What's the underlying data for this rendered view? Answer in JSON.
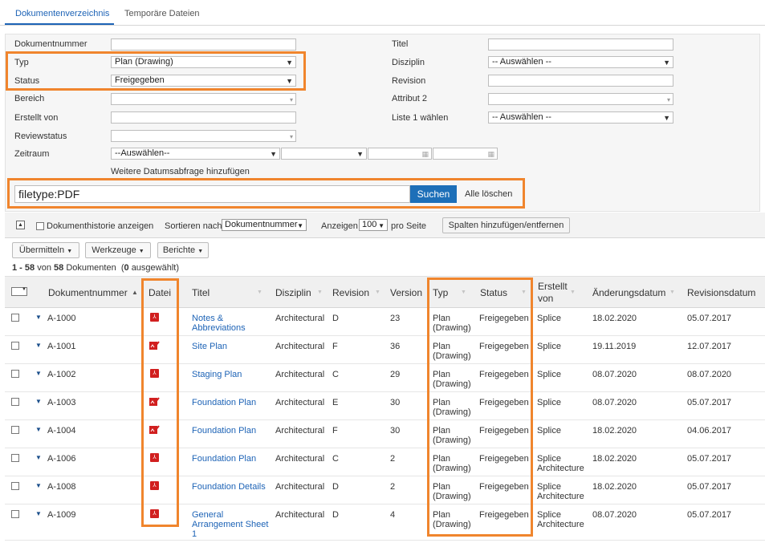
{
  "tabs": [
    {
      "label": "Dokumentenverzeichnis"
    },
    {
      "label": "Temporäre Dateien"
    }
  ],
  "filters": {
    "dokumentnummer_label": "Dokumentnummer",
    "typ_label": "Typ",
    "typ_value": "Plan (Drawing)",
    "status_label": "Status",
    "status_value": "Freigegeben",
    "bereich_label": "Bereich",
    "erstellt_von_label": "Erstellt von",
    "reviewstatus_label": "Reviewstatus",
    "zeitraum_label": "Zeitraum",
    "zeitraum_value": "--Auswählen--",
    "weitere_link": "Weitere Datumsabfrage hinzufügen",
    "titel_label": "Titel",
    "disziplin_label": "Disziplin",
    "disziplin_value": "-- Auswählen --",
    "revision_label": "Revision",
    "attribut2_label": "Attribut 2",
    "liste1_label": "Liste 1 wählen",
    "liste1_value": "-- Auswählen --"
  },
  "search": {
    "query": "filetype:PDF",
    "button_label": "Suchen",
    "clear_label": "Alle löschen"
  },
  "toolbar": {
    "history_label": "Dokumenthistorie anzeigen",
    "sort_label": "Sortieren nach",
    "sort_value": "Dokumentnummer",
    "show_label": "Anzeigen",
    "show_value": "100",
    "per_page_label": "pro Seite",
    "columns_button": "Spalten hinzufügen/entfernen",
    "submit_button": "Übermitteln",
    "tools_button": "Werkzeuge",
    "reports_button": "Berichte"
  },
  "count": {
    "range": "1 - 58",
    "von": "von",
    "total": "58",
    "docs": "Dokumenten",
    "open_paren": "(",
    "selected": "0",
    "selected_suffix": "ausgewählt)"
  },
  "table": {
    "headers": {
      "docnum": "Dokumentnummer",
      "datei": "Datei",
      "titel": "Titel",
      "disziplin": "Disziplin",
      "revision": "Revision",
      "version": "Version",
      "typ": "Typ",
      "status": "Status",
      "erstellt_line1": "Erstellt",
      "erstellt_line2": "von",
      "aenderung": "Änderungsdatum",
      "revisionsdatum": "Revisionsdatum"
    },
    "rows": [
      {
        "num": "A-1000",
        "file": "pdf",
        "title1": "Notes &",
        "title2": "Abbreviations",
        "title3": "",
        "disc": "Architectural",
        "rev": "D",
        "ver": "23",
        "typ1": "Plan",
        "typ2": "(Drawing)",
        "status": "Freigegeben",
        "by1": "Splice",
        "by2": "",
        "changed": "18.02.2020",
        "revdate": "05.07.2017"
      },
      {
        "num": "A-1001",
        "file": "pdf-edit",
        "title1": "Site Plan",
        "title2": "",
        "title3": "",
        "disc": "Architectural",
        "rev": "F",
        "ver": "36",
        "typ1": "Plan",
        "typ2": "(Drawing)",
        "status": "Freigegeben",
        "by1": "Splice",
        "by2": "",
        "changed": "19.11.2019",
        "revdate": "12.07.2017"
      },
      {
        "num": "A-1002",
        "file": "pdf",
        "title1": "Staging Plan",
        "title2": "",
        "title3": "",
        "disc": "Architectural",
        "rev": "C",
        "ver": "29",
        "typ1": "Plan",
        "typ2": "(Drawing)",
        "status": "Freigegeben",
        "by1": "Splice",
        "by2": "",
        "changed": "08.07.2020",
        "revdate": "08.07.2020"
      },
      {
        "num": "A-1003",
        "file": "pdf-edit",
        "title1": "Foundation Plan",
        "title2": "",
        "title3": "",
        "disc": "Architectural",
        "rev": "E",
        "ver": "30",
        "typ1": "Plan",
        "typ2": "(Drawing)",
        "status": "Freigegeben",
        "by1": "Splice",
        "by2": "",
        "changed": "08.07.2020",
        "revdate": "05.07.2017"
      },
      {
        "num": "A-1004",
        "file": "pdf-edit",
        "title1": "Foundation Plan",
        "title2": "",
        "title3": "",
        "disc": "Architectural",
        "rev": "F",
        "ver": "30",
        "typ1": "Plan",
        "typ2": "(Drawing)",
        "status": "Freigegeben",
        "by1": "Splice",
        "by2": "",
        "changed": "18.02.2020",
        "revdate": "04.06.2017"
      },
      {
        "num": "A-1006",
        "file": "pdf",
        "title1": "Foundation Plan",
        "title2": "",
        "title3": "",
        "disc": "Architectural",
        "rev": "C",
        "ver": "2",
        "typ1": "Plan",
        "typ2": "(Drawing)",
        "status": "Freigegeben",
        "by1": "Splice",
        "by2": "Architecture",
        "changed": "18.02.2020",
        "revdate": "05.07.2017"
      },
      {
        "num": "A-1008",
        "file": "pdf",
        "title1": "Foundation Details",
        "title2": "",
        "title3": "",
        "disc": "Architectural",
        "rev": "D",
        "ver": "2",
        "typ1": "Plan",
        "typ2": "(Drawing)",
        "status": "Freigegeben",
        "by1": "Splice",
        "by2": "Architecture",
        "changed": "18.02.2020",
        "revdate": "05.07.2017"
      },
      {
        "num": "A-1009",
        "file": "pdf",
        "title1": "General",
        "title2": "Arrangement Sheet",
        "title3": "1",
        "disc": "Architectural",
        "rev": "D",
        "ver": "4",
        "typ1": "Plan",
        "typ2": "(Drawing)",
        "status": "Freigegeben",
        "by1": "Splice",
        "by2": "Architecture",
        "changed": "08.07.2020",
        "revdate": "05.07.2017"
      }
    ]
  },
  "icons": {
    "pdf": "pdf-icon",
    "pdf_edit": "pdf-edit-icon",
    "row_expand": "caret-down-icon"
  },
  "colors": {
    "accent": "#1d63b6",
    "highlight": "#f0852d",
    "pdf": "#d11f1f"
  }
}
